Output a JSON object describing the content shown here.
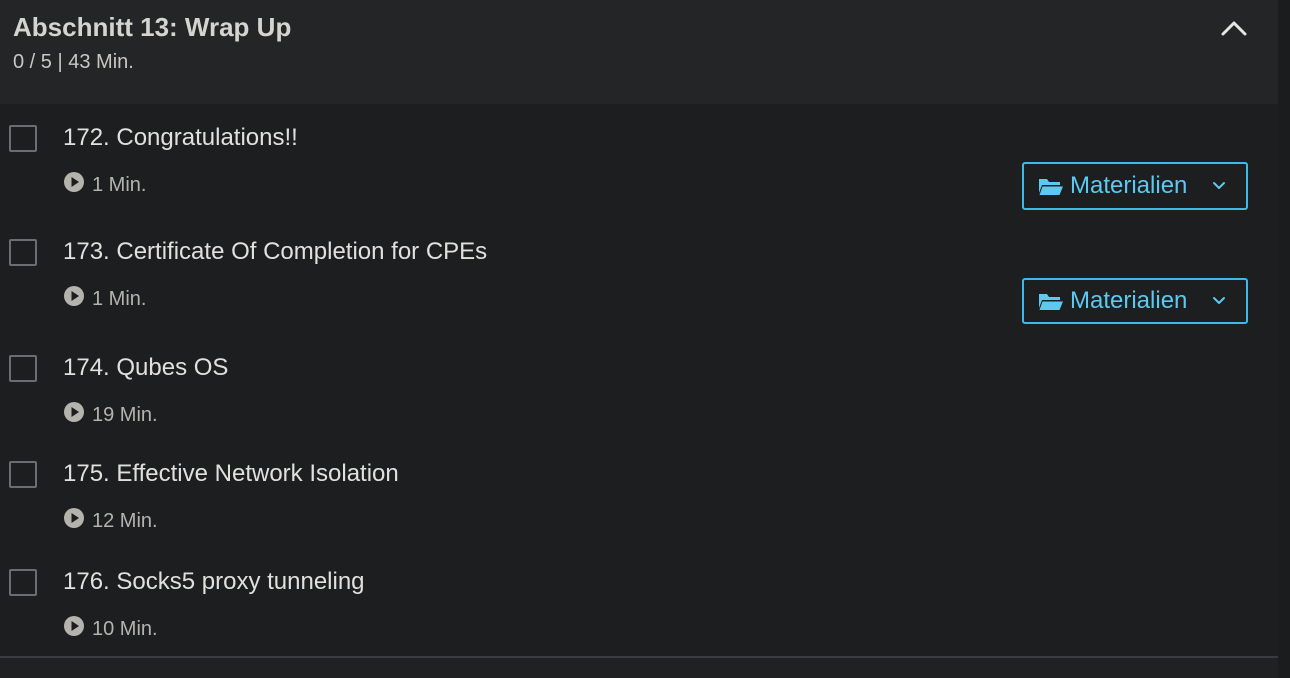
{
  "section": {
    "title": "Abschnitt 13: Wrap Up",
    "meta": "0 / 5 | 43 Min.",
    "toggle_icon": "chevron-up-icon"
  },
  "lectures": [
    {
      "title": "172. Congratulations!!",
      "duration": "1 Min.",
      "completed": false,
      "has_materials": true,
      "materials_label": "Materialien"
    },
    {
      "title": "173. Certificate Of Completion for CPEs",
      "duration": "1 Min.",
      "completed": false,
      "has_materials": true,
      "materials_label": "Materialien"
    },
    {
      "title": "174. Qubes OS",
      "duration": "19 Min.",
      "completed": false,
      "has_materials": false
    },
    {
      "title": "175. Effective Network Isolation",
      "duration": "12 Min.",
      "completed": false,
      "has_materials": false
    },
    {
      "title": "176. Socks5 proxy tunneling",
      "duration": "10 Min.",
      "completed": false,
      "has_materials": false
    }
  ],
  "colors": {
    "background": "#1c1e20",
    "header_background": "#232527",
    "accent": "#5cc9f2",
    "text": "#e2e0dc",
    "muted_text": "#b5b3ae"
  },
  "icons": {
    "play": "play-circle-icon",
    "folder": "folder-open-icon",
    "caret": "chevron-down-icon"
  }
}
